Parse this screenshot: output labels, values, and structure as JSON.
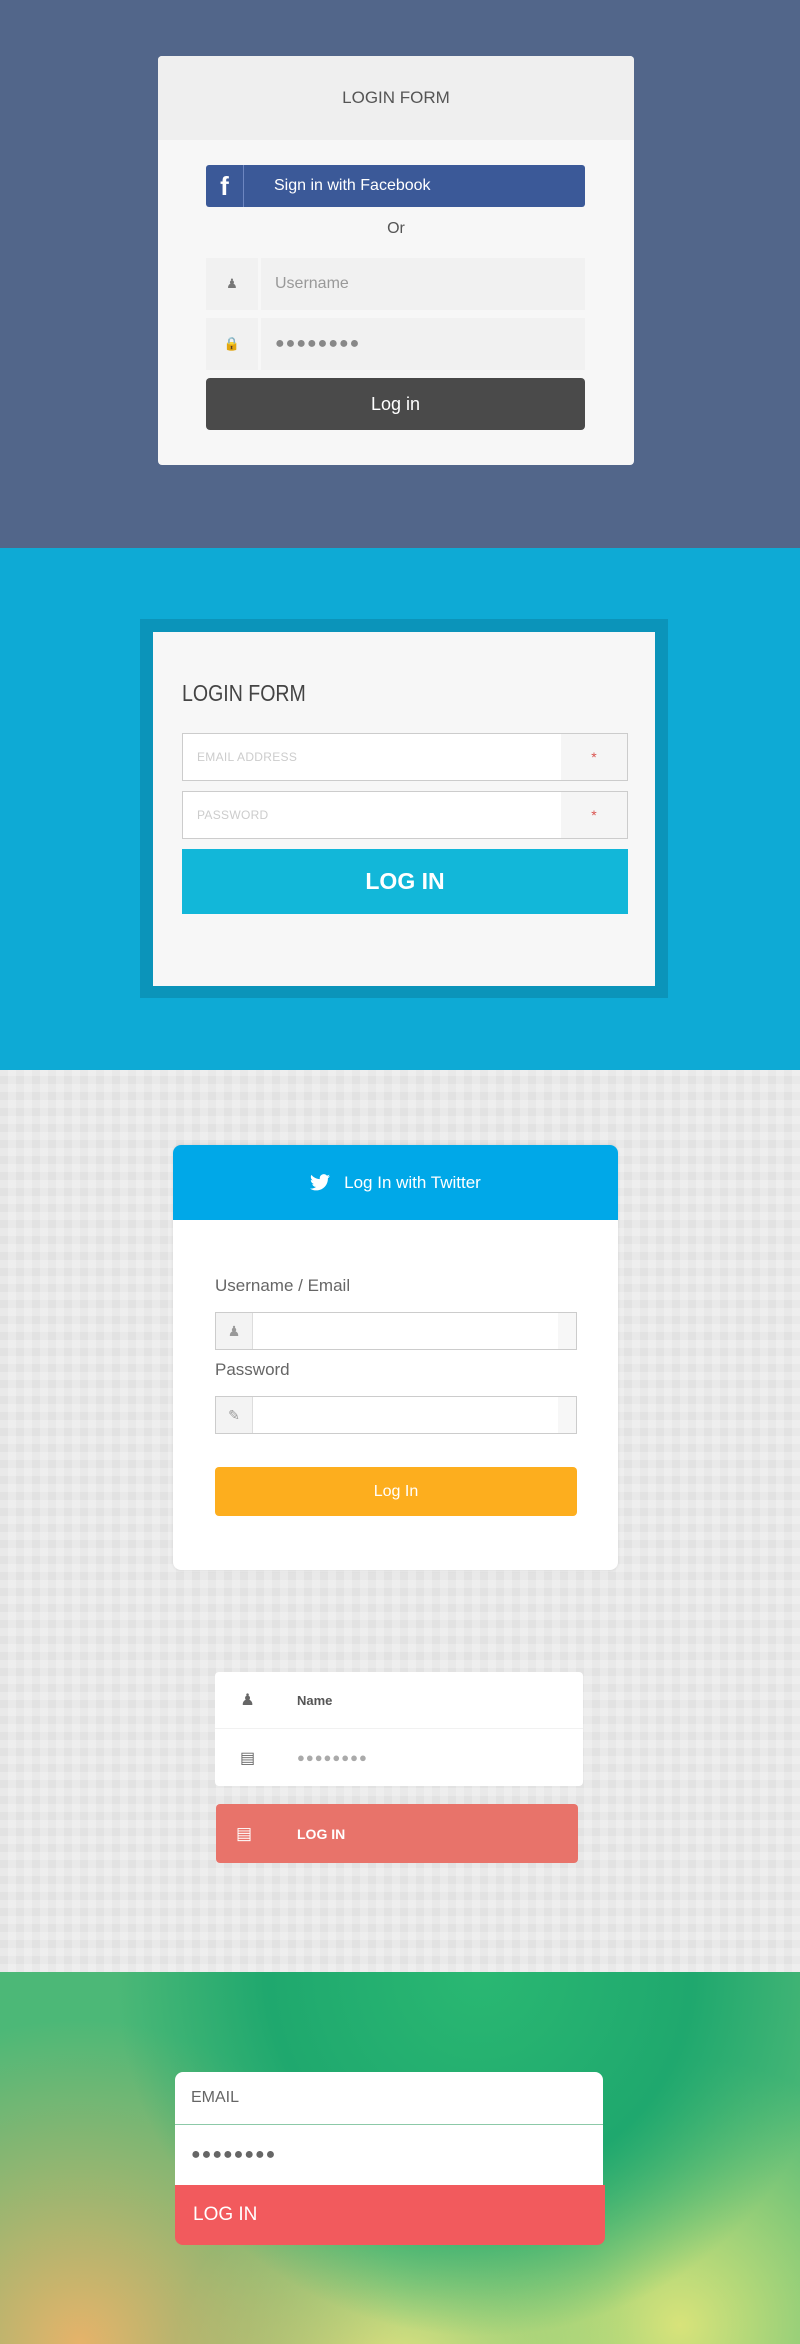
{
  "form1": {
    "title": "LOGIN FORM",
    "facebook_label": "Sign in with Facebook",
    "facebook_icon": "f",
    "or": "Or",
    "username_placeholder": "Username",
    "password_value": "●●●●●●●●",
    "login": "Log in",
    "bg": "#52668a",
    "facebook_color": "#3b5998"
  },
  "form2": {
    "title": "LOGIN FORM",
    "email_placeholder": "EMAIL ADDRESS",
    "password_placeholder": "PASSWORD",
    "required_mark": "*",
    "login": "LOG IN",
    "accent": "#12b7d9"
  },
  "form3": {
    "header": "Log In with Twitter",
    "username_label": "Username / Email",
    "password_label": "Password",
    "login": "Log In",
    "header_color": "#00a8e8",
    "button_color": "#fdae1e"
  },
  "form4": {
    "name_placeholder": "Name",
    "password_value": "●●●●●●●●",
    "login": "LOG IN",
    "button_color": "#e8736a"
  },
  "form5": {
    "email_placeholder": "EMAIL",
    "password_value": "●●●●●●●●",
    "login": "LOG IN",
    "button_color": "#f25a5d"
  }
}
